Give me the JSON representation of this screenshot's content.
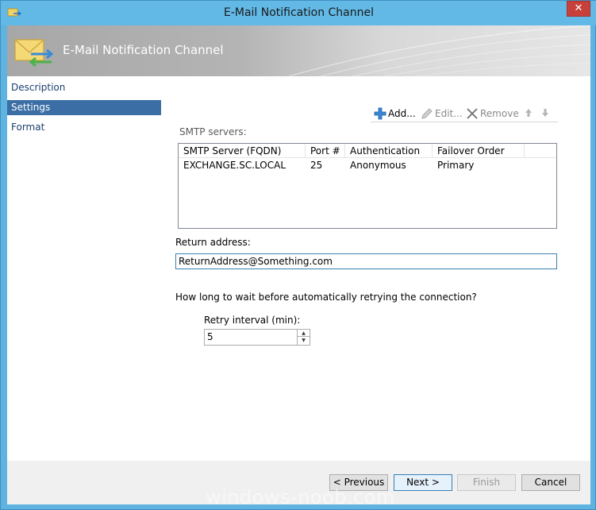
{
  "window": {
    "title": "E-Mail Notification Channel",
    "close_glyph": "✕"
  },
  "header": {
    "title": "E-Mail Notification Channel",
    "icon": "envelope-arrows-icon"
  },
  "nav": {
    "items": [
      {
        "label": "Description",
        "active": false
      },
      {
        "label": "Settings",
        "active": true
      },
      {
        "label": "Format",
        "active": false
      }
    ]
  },
  "toolbar": {
    "add_label": "Add...",
    "edit_label": "Edit...",
    "remove_label": "Remove"
  },
  "smtp": {
    "label": "SMTP servers:",
    "columns": [
      "SMTP Server (FQDN)",
      "Port #",
      "Authentication",
      "Failover Order"
    ],
    "rows": [
      {
        "server": "EXCHANGE.SC.LOCAL",
        "port": "25",
        "auth": "Anonymous",
        "order": "Primary"
      }
    ]
  },
  "return_address": {
    "label": "Return address:",
    "value": "ReturnAddress@Something.com"
  },
  "retry": {
    "question": "How long to wait before automatically retrying the connection?",
    "label": "Retry interval (min):",
    "value": "5"
  },
  "footer": {
    "previous_label": "< Previous",
    "next_label": "Next >",
    "finish_label": "Finish",
    "cancel_label": "Cancel"
  },
  "watermark": "windows-noob.com",
  "colors": {
    "selection": "#3a6ea5",
    "window_frame": "#62b9e6",
    "close": "#c7403a"
  }
}
